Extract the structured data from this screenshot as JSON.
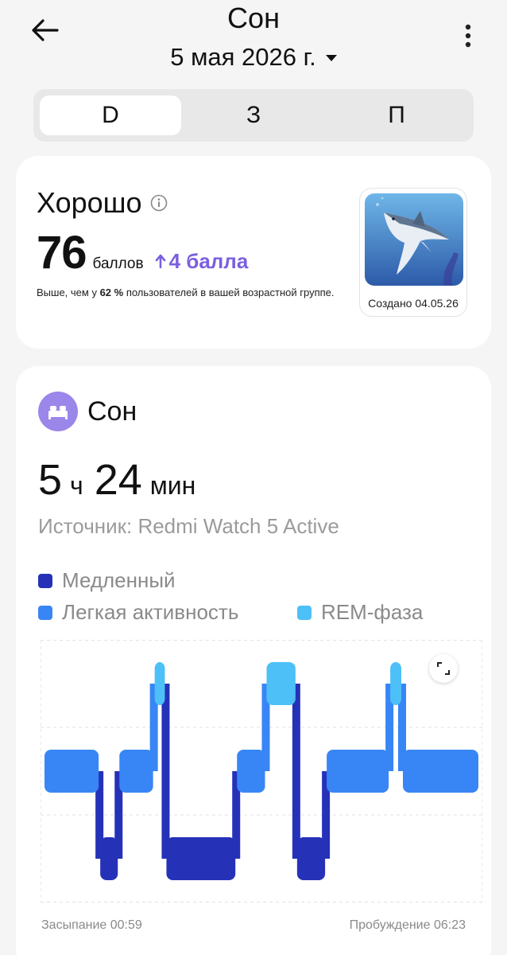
{
  "header": {
    "title": "Сон",
    "date": "5 мая 2026 г."
  },
  "tabs": [
    {
      "label": "D",
      "active": true
    },
    {
      "label": "З",
      "active": false
    },
    {
      "label": "П",
      "active": false
    }
  ],
  "score": {
    "label": "Хорошо",
    "value": "76",
    "unit": "баллов",
    "delta": "4 балла",
    "compare_prefix": "Выше, чем у ",
    "compare_percent": "62 %",
    "compare_suffix": " пользователей в вашей возрастной группе.",
    "badge_caption": "Создано 04.05.26"
  },
  "sleep": {
    "title": "Сон",
    "hours": "5",
    "hours_unit": "ч",
    "minutes": "24",
    "minutes_unit": "мин",
    "source": "Источник: Redmi Watch 5 Active"
  },
  "legend": [
    {
      "label": "Медленный",
      "color": "#2532b8"
    },
    {
      "label": "Легкая активность",
      "color": "#3886f5"
    },
    {
      "label": "REM-фаза",
      "color": "#4cc0f7"
    }
  ],
  "chart_data": {
    "type": "hypnogram",
    "x_start": "00:59",
    "x_end": "06:23",
    "start_label": "Засыпание 00:59",
    "end_label": "Пробуждение 06:23",
    "stage_levels": {
      "rem": 0,
      "light": 1,
      "deep": 2
    },
    "segments": [
      {
        "stage": "light",
        "start": 0.0,
        "end": 0.128
      },
      {
        "stage": "deep",
        "start": 0.128,
        "end": 0.172
      },
      {
        "stage": "light",
        "start": 0.172,
        "end": 0.253
      },
      {
        "stage": "rem",
        "start": 0.253,
        "end": 0.28
      },
      {
        "stage": "deep",
        "start": 0.28,
        "end": 0.442
      },
      {
        "stage": "light",
        "start": 0.442,
        "end": 0.51
      },
      {
        "stage": "rem",
        "start": 0.51,
        "end": 0.58
      },
      {
        "stage": "deep",
        "start": 0.58,
        "end": 0.648
      },
      {
        "stage": "light",
        "start": 0.648,
        "end": 0.794
      },
      {
        "stage": "rem",
        "start": 0.794,
        "end": 0.823
      },
      {
        "stage": "light",
        "start": 0.823,
        "end": 1.0
      }
    ]
  }
}
